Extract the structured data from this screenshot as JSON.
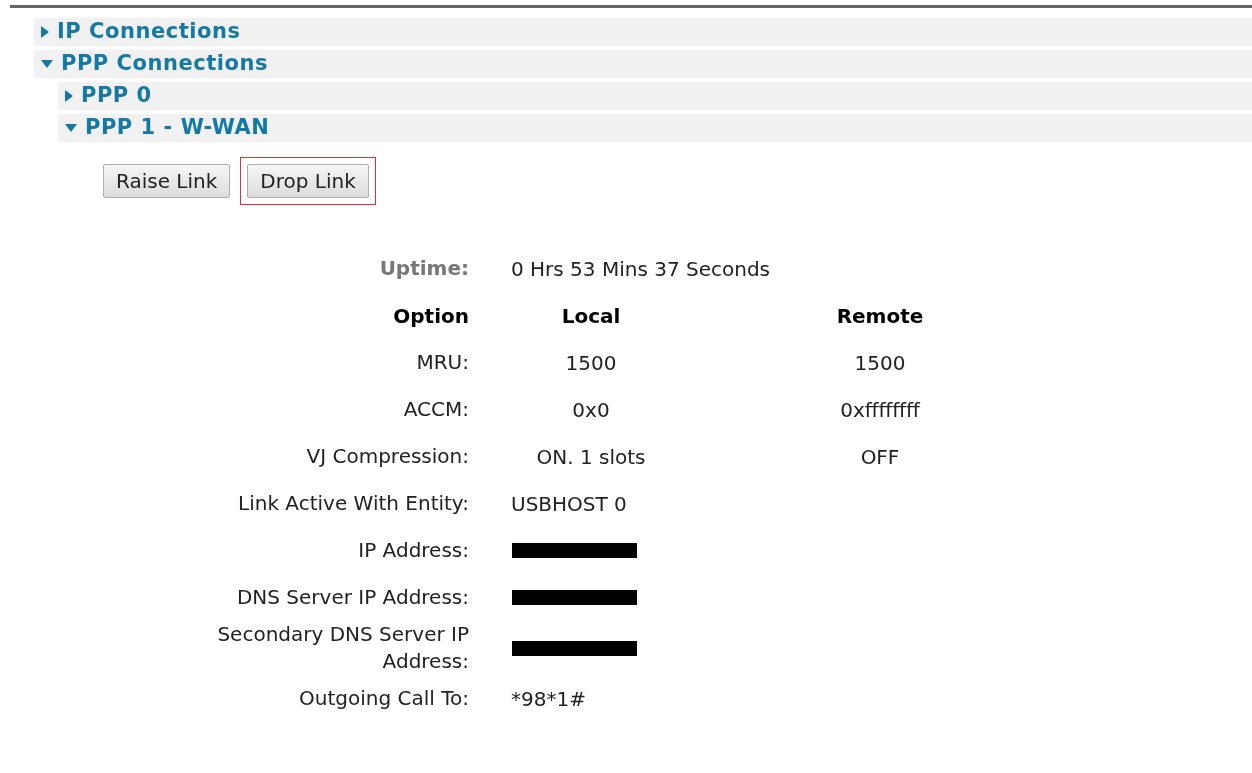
{
  "tree": [
    {
      "label": "IP Connections",
      "expanded": false
    },
    {
      "label": "PPP Connections",
      "expanded": true,
      "children": [
        {
          "label": "PPP 0",
          "expanded": false
        },
        {
          "label": "PPP 1 - W-WAN",
          "expanded": true
        }
      ]
    }
  ],
  "buttons": [
    {
      "label": "Raise Link",
      "focused": false
    },
    {
      "label": "Drop Link",
      "focused": true
    }
  ],
  "uptime": {
    "label": "Uptime:",
    "value": "0 Hrs 53 Mins 37 Seconds"
  },
  "options_table": {
    "columns": [
      "Option",
      "Local",
      "Remote"
    ],
    "rows": [
      {
        "kind": "pair",
        "label": "MRU:",
        "local": "1500",
        "remote": "1500"
      },
      {
        "kind": "pair",
        "label": "ACCM:",
        "local": "0x0",
        "remote": "0xffffffff"
      },
      {
        "kind": "pair",
        "label": "VJ Compression:",
        "local": "ON. 1 slots",
        "remote": "OFF"
      },
      {
        "kind": "single",
        "label": "Link Active With Entity:",
        "value": "USBHOST 0"
      },
      {
        "kind": "redacted",
        "label": "IP Address:"
      },
      {
        "kind": "redacted",
        "label": "DNS Server IP Address:"
      },
      {
        "kind": "redacted",
        "label": "Secondary DNS Server IP Address:"
      },
      {
        "kind": "single",
        "label": "Outgoing Call To:",
        "value": "*98*1#"
      }
    ]
  }
}
